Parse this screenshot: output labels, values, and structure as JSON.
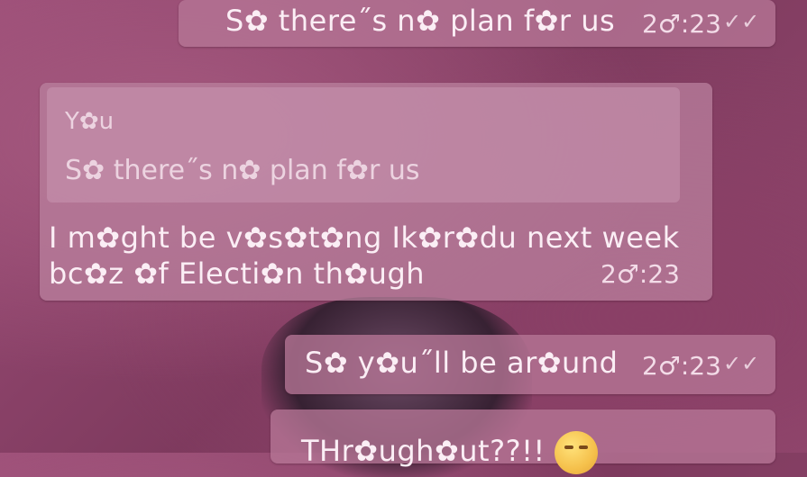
{
  "messages": [
    {
      "text": "S✿ there˝s n✿ plan f✿r us",
      "time": "2♂:23",
      "ticks": "✓✓"
    },
    {
      "quote": {
        "author": "Y✿u",
        "text": "S✿ there˝s n✿ plan f✿r us"
      },
      "text": "I m✿ght be v✿s✿t✿ng Ik✿r✿du next week bc✿z ✿f Electi✿n th✿ugh",
      "time": "2♂:23"
    },
    {
      "text": "S✿ y✿u˝ll be ar✿und",
      "time": "2♂:23",
      "ticks": "✓✓"
    },
    {
      "text": "THr✿ugh✿ut??!!",
      "emoji": "smiling-face-emoji"
    }
  ]
}
